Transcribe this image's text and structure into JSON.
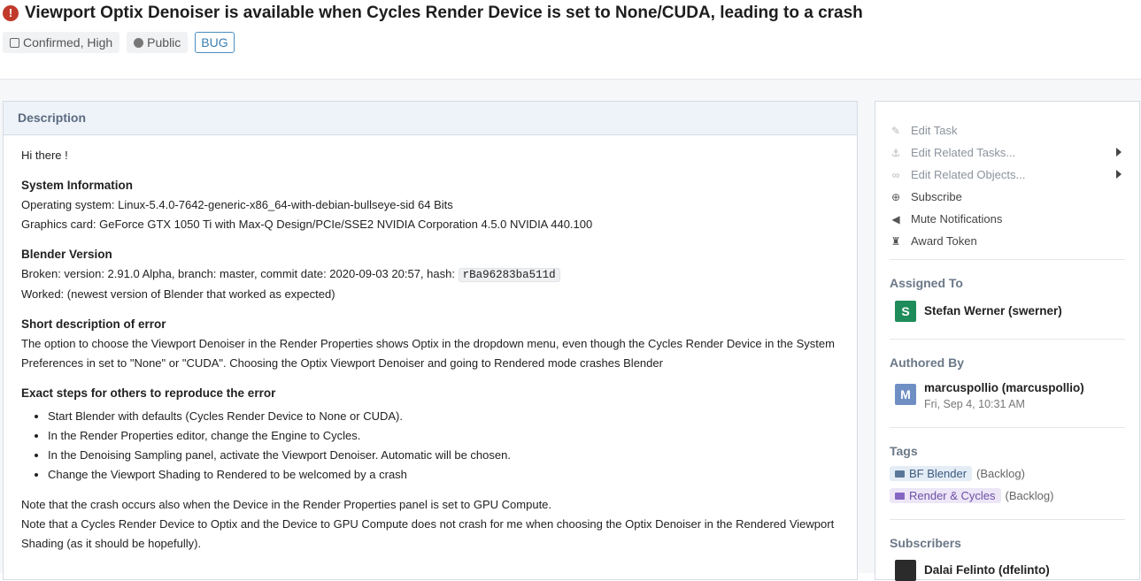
{
  "task": {
    "title": "Viewport Optix Denoiser is available when Cycles Render Device is set to None/CUDA, leading to a crash",
    "status_badge": "Confirmed, High",
    "visibility_badge": "Public",
    "type_badge": "BUG"
  },
  "description": {
    "heading": "Description",
    "greeting": "Hi there !",
    "sysinfo_heading": "System Information",
    "os_line": "Operating system: Linux-5.4.0-7642-generic-x86_64-with-debian-bullseye-sid 64 Bits",
    "gpu_line": "Graphics card: GeForce GTX 1050 Ti with Max-Q Design/PCIe/SSE2 NVIDIA Corporation 4.5.0 NVIDIA 440.100",
    "version_heading": "Blender Version",
    "broken_line": "Broken: version: 2.91.0 Alpha, branch: master, commit date: 2020-09-03 20:57, hash:",
    "hash": "rBa96283ba511d",
    "worked_line": "Worked: (newest version of Blender that worked as expected)",
    "short_heading": "Short description of error",
    "short_text": "The option to choose the Viewport Denoiser in the Render Properties shows Optix in the dropdown menu, even though the Cycles Render Device in the System Preferences in set to \"None\" or \"CUDA\". Choosing the Optix Viewport Denoiser and going to Rendered mode crashes Blender",
    "steps_heading": "Exact steps for others to reproduce the error",
    "steps": [
      "Start Blender with defaults (Cycles Render Device to None or CUDA).",
      "In the Render Properties editor, change the Engine to Cycles.",
      "In the Denoising Sampling panel, activate the Viewport Denoiser. Automatic will be chosen.",
      "Change the Viewport Shading to Rendered to be welcomed by a crash"
    ],
    "note1": "Note that the crash occurs also when the Device in the Render Properties panel is set to GPU Compute.",
    "note2": "Note that a Cycles Render Device to Optix and the Device to GPU Compute does not crash for me when choosing the Optix Denoiser in the Rendered Viewport Shading (as it should be hopefully)."
  },
  "sidebar": {
    "actions": [
      {
        "label": "Edit Task",
        "icon": "pencil-icon"
      },
      {
        "label": "Edit Related Tasks...",
        "icon": "anchor-icon"
      },
      {
        "label": "Edit Related Objects...",
        "icon": "link-icon"
      },
      {
        "label": "Subscribe",
        "icon": "plus-circle-icon"
      },
      {
        "label": "Mute Notifications",
        "icon": "volume-icon"
      },
      {
        "label": "Award Token",
        "icon": "trophy-icon"
      }
    ],
    "assigned_heading": "Assigned To",
    "assignee": {
      "initial": "S",
      "name": "Stefan Werner (swerner)",
      "color": "#1e8c5a"
    },
    "authored_heading": "Authored By",
    "author": {
      "initial": "M",
      "name": "marcuspollio (marcuspollio)",
      "date": "Fri, Sep 4, 10:31 AM",
      "color": "#6f8fc4"
    },
    "tags_heading": "Tags",
    "tags": [
      {
        "label": "BF Blender",
        "note": "(Backlog)"
      },
      {
        "label": "Render & Cycles",
        "note": "(Backlog)"
      }
    ],
    "subscribers_heading": "Subscribers",
    "subscriber": {
      "name": "Dalai Felinto (dfelinto)"
    }
  }
}
